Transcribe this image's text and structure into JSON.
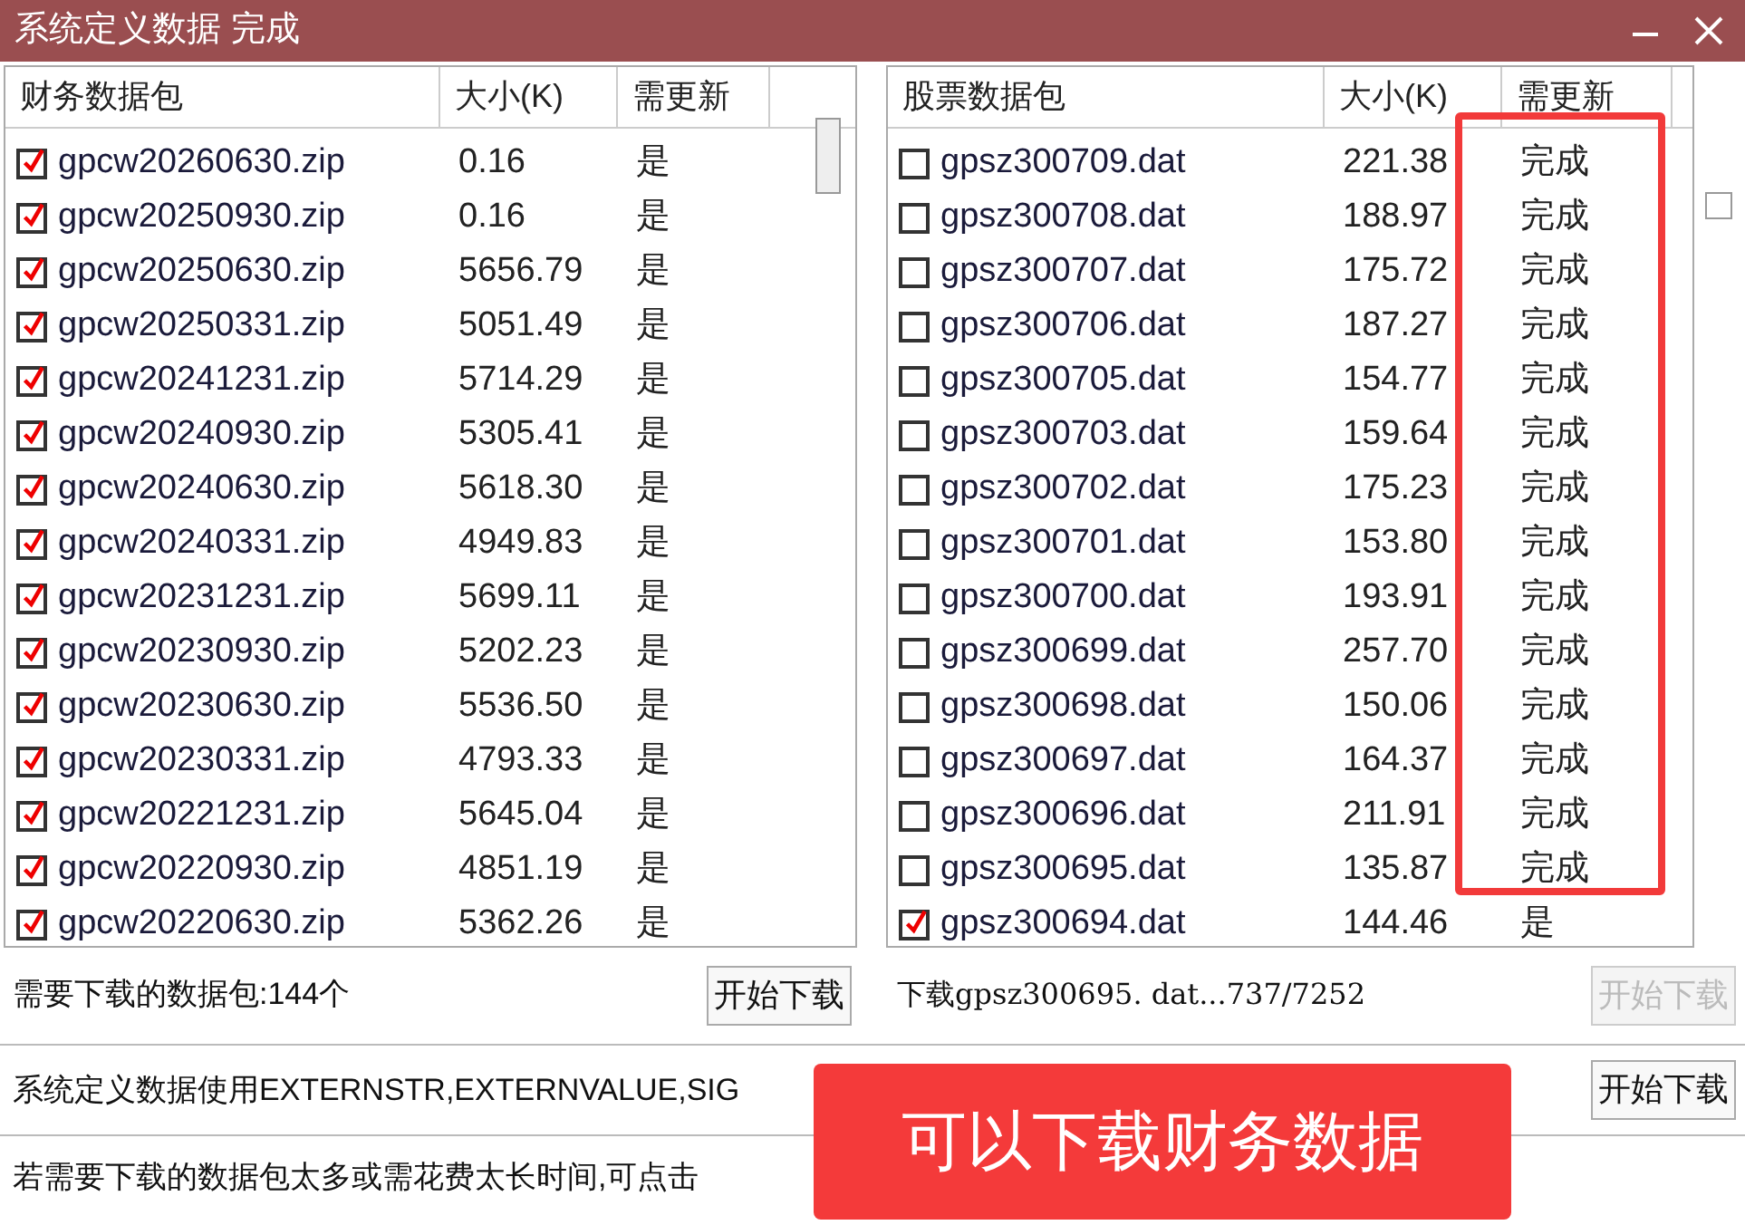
{
  "window": {
    "title": "系统定义数据 完成"
  },
  "left_list": {
    "columns": [
      "财务数据包",
      "大小(K)",
      "需更新"
    ],
    "rows": [
      {
        "checked": true,
        "name": "gpcw20260630.zip",
        "size": "0.16",
        "update": "是"
      },
      {
        "checked": true,
        "name": "gpcw20250930.zip",
        "size": "0.16",
        "update": "是"
      },
      {
        "checked": true,
        "name": "gpcw20250630.zip",
        "size": "5656.79",
        "update": "是"
      },
      {
        "checked": true,
        "name": "gpcw20250331.zip",
        "size": "5051.49",
        "update": "是"
      },
      {
        "checked": true,
        "name": "gpcw20241231.zip",
        "size": "5714.29",
        "update": "是"
      },
      {
        "checked": true,
        "name": "gpcw20240930.zip",
        "size": "5305.41",
        "update": "是"
      },
      {
        "checked": true,
        "name": "gpcw20240630.zip",
        "size": "5618.30",
        "update": "是"
      },
      {
        "checked": true,
        "name": "gpcw20240331.zip",
        "size": "4949.83",
        "update": "是"
      },
      {
        "checked": true,
        "name": "gpcw20231231.zip",
        "size": "5699.11",
        "update": "是"
      },
      {
        "checked": true,
        "name": "gpcw20230930.zip",
        "size": "5202.23",
        "update": "是"
      },
      {
        "checked": true,
        "name": "gpcw20230630.zip",
        "size": "5536.50",
        "update": "是"
      },
      {
        "checked": true,
        "name": "gpcw20230331.zip",
        "size": "4793.33",
        "update": "是"
      },
      {
        "checked": true,
        "name": "gpcw20221231.zip",
        "size": "5645.04",
        "update": "是"
      },
      {
        "checked": true,
        "name": "gpcw20220930.zip",
        "size": "4851.19",
        "update": "是"
      },
      {
        "checked": true,
        "name": "gpcw20220630.zip",
        "size": "5362.26",
        "update": "是"
      }
    ]
  },
  "right_list": {
    "columns": [
      "股票数据包",
      "大小(K)",
      "需更新"
    ],
    "rows": [
      {
        "checked": false,
        "name": "gpsz300709.dat",
        "size": "221.38",
        "update": "完成"
      },
      {
        "checked": false,
        "name": "gpsz300708.dat",
        "size": "188.97",
        "update": "完成"
      },
      {
        "checked": false,
        "name": "gpsz300707.dat",
        "size": "175.72",
        "update": "完成"
      },
      {
        "checked": false,
        "name": "gpsz300706.dat",
        "size": "187.27",
        "update": "完成"
      },
      {
        "checked": false,
        "name": "gpsz300705.dat",
        "size": "154.77",
        "update": "完成"
      },
      {
        "checked": false,
        "name": "gpsz300703.dat",
        "size": "159.64",
        "update": "完成"
      },
      {
        "checked": false,
        "name": "gpsz300702.dat",
        "size": "175.23",
        "update": "完成"
      },
      {
        "checked": false,
        "name": "gpsz300701.dat",
        "size": "153.80",
        "update": "完成"
      },
      {
        "checked": false,
        "name": "gpsz300700.dat",
        "size": "193.91",
        "update": "完成"
      },
      {
        "checked": false,
        "name": "gpsz300699.dat",
        "size": "257.70",
        "update": "完成"
      },
      {
        "checked": false,
        "name": "gpsz300698.dat",
        "size": "150.06",
        "update": "完成"
      },
      {
        "checked": false,
        "name": "gpsz300697.dat",
        "size": "164.37",
        "update": "完成"
      },
      {
        "checked": false,
        "name": "gpsz300696.dat",
        "size": "211.91",
        "update": "完成"
      },
      {
        "checked": false,
        "name": "gpsz300695.dat",
        "size": "135.87",
        "update": "完成"
      },
      {
        "checked": true,
        "name": "gpsz300694.dat",
        "size": "144.46",
        "update": "是"
      }
    ]
  },
  "side_checkbox": {
    "checked": false
  },
  "finance_download": {
    "label": "需要下载的数据包:144个",
    "button": {
      "label": "开始下载",
      "disabled": false
    }
  },
  "stock_download": {
    "label": "下载gpsz300695. dat...737/7252",
    "button": {
      "label": "开始下载",
      "disabled": true
    }
  },
  "custom_data": {
    "label": "系统定义数据使用EXTERNSTR,EXTERNVALUE,SIG",
    "button": {
      "label": "开始下载",
      "disabled": false
    }
  },
  "hint": "若需要下载的数据包太多或需花费太长时间,可点击",
  "toast": "可以下载财务数据"
}
